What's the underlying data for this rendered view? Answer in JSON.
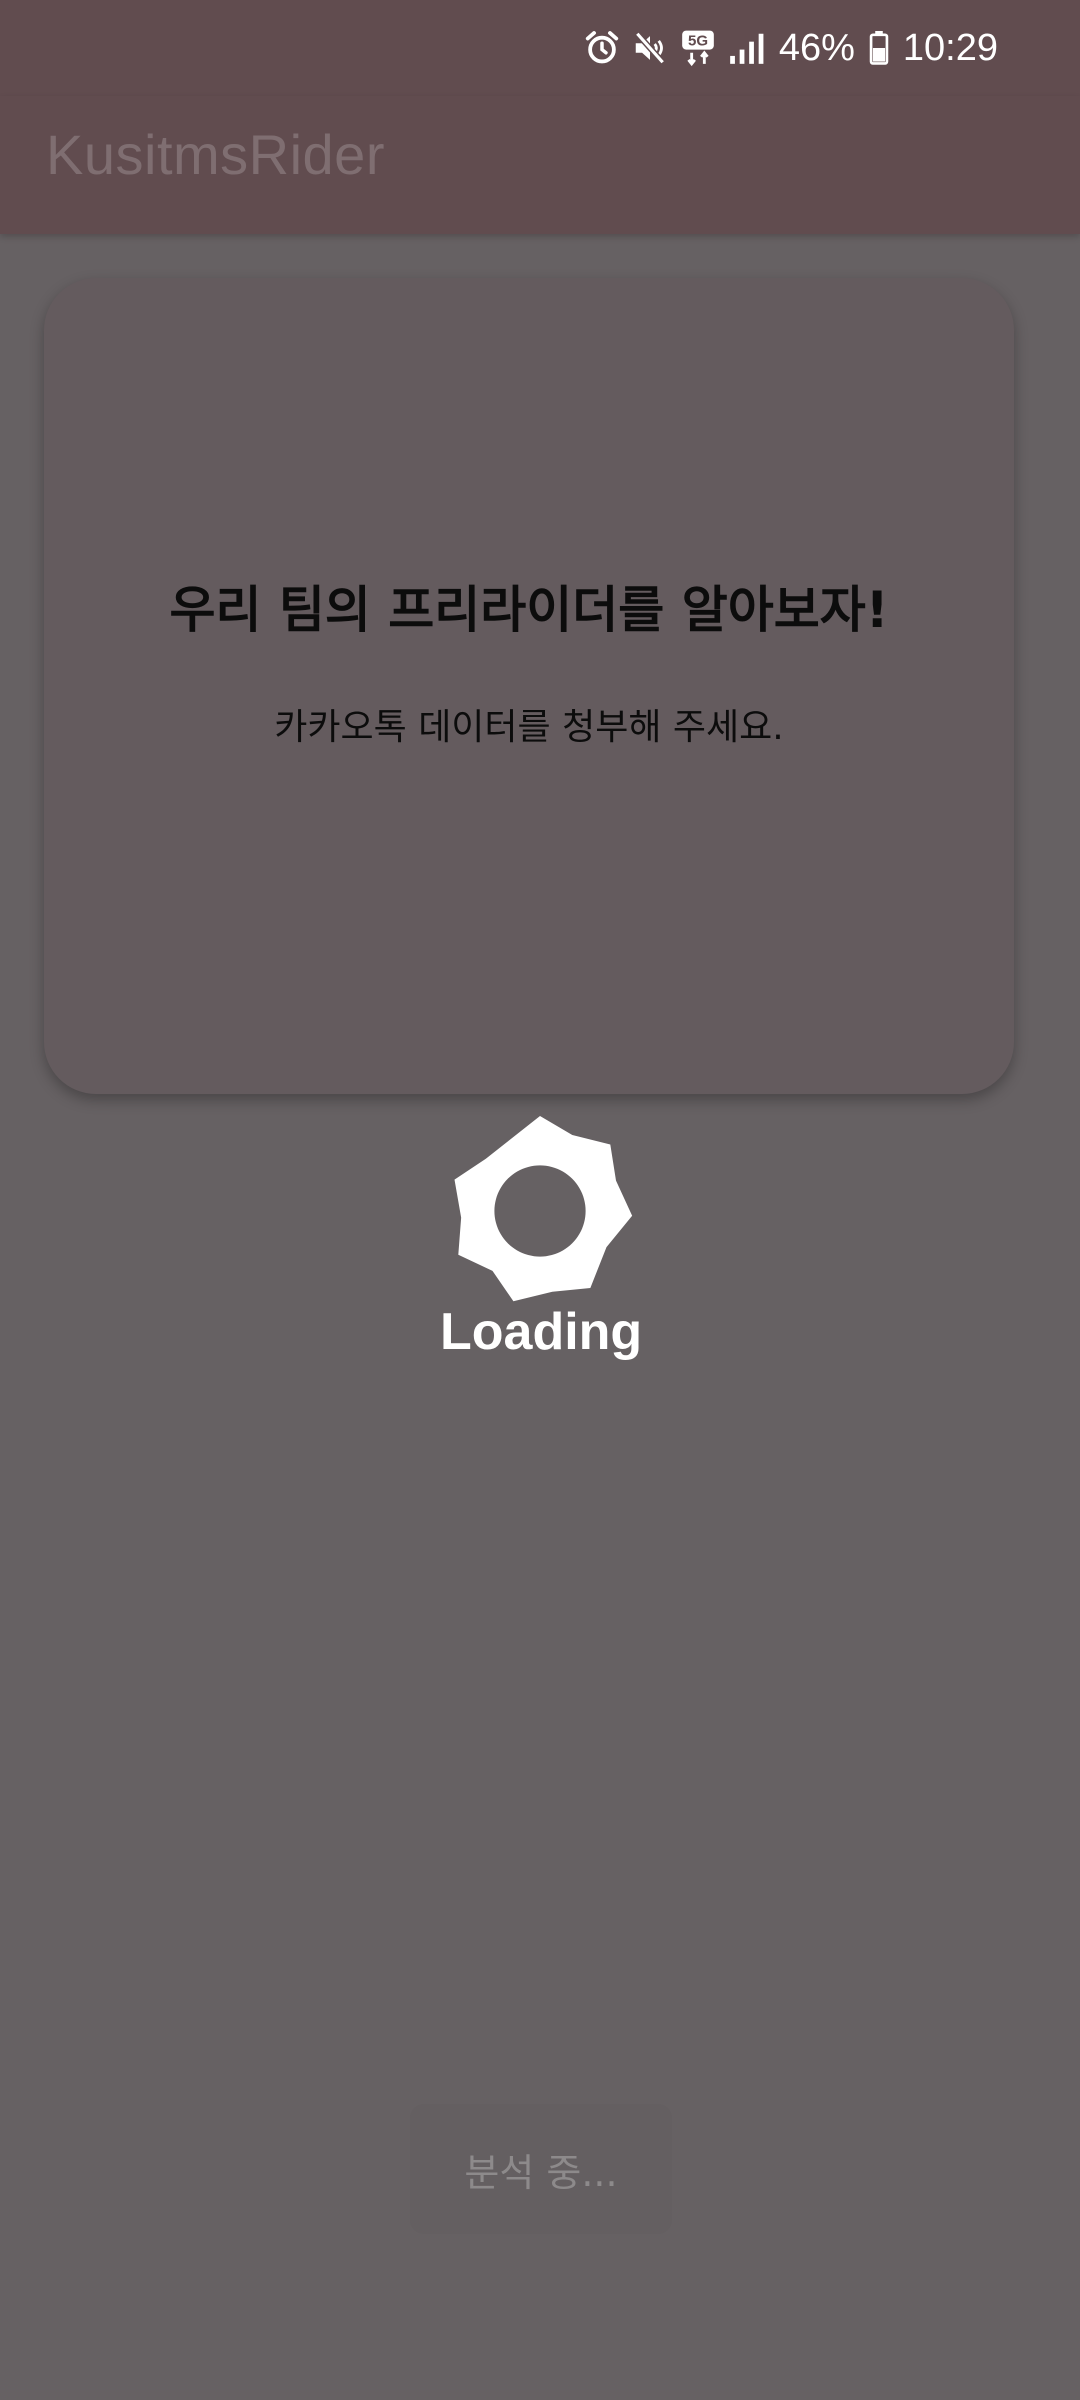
{
  "status_bar": {
    "icons": [
      "alarm-icon",
      "mute-icon",
      "5g-icon",
      "signal-icon"
    ],
    "network_label": "5G",
    "battery_percent": "46%",
    "time": "10:29"
  },
  "app_bar": {
    "title": "KusitmsRider"
  },
  "card": {
    "title": "우리 팀의 프리라이더를 알아보자!",
    "subtitle": "카카오톡 데이터를 청부해 주세요."
  },
  "loader": {
    "icon": "gear-loading-icon",
    "label": "Loading"
  },
  "status_chip": {
    "label": "분석 중..."
  },
  "colors": {
    "background": "#666163",
    "app_bar": "#614c4f",
    "card": "#645b5e",
    "white": "#ffffff"
  }
}
